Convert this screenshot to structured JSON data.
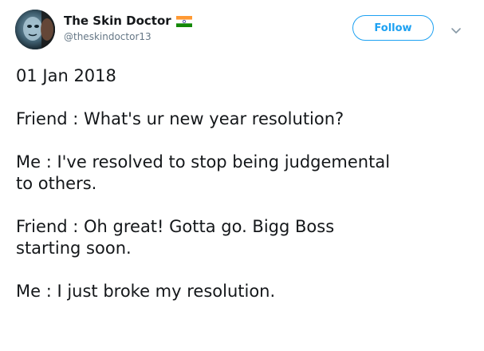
{
  "author": {
    "display_name": "The Skin Doctor",
    "handle": "@theskindoctor13",
    "flag_icon": "india-flag-icon",
    "avatar_icon": "avatar-image"
  },
  "actions": {
    "follow_label": "Follow",
    "menu_icon": "chevron-down-icon"
  },
  "colors": {
    "accent": "#1da1f2",
    "text": "#14171a",
    "muted": "#657786"
  },
  "tweet": {
    "line_1": "01 Jan 2018",
    "line_2": "Friend : What's ur new year resolution?",
    "line_3a": "Me : I've resolved to stop being judgemental",
    "line_3b": "to others.",
    "line_4a": "Friend : Oh great! Gotta go. Bigg Boss",
    "line_4b": "starting soon.",
    "line_5": "Me : I just broke my resolution."
  }
}
